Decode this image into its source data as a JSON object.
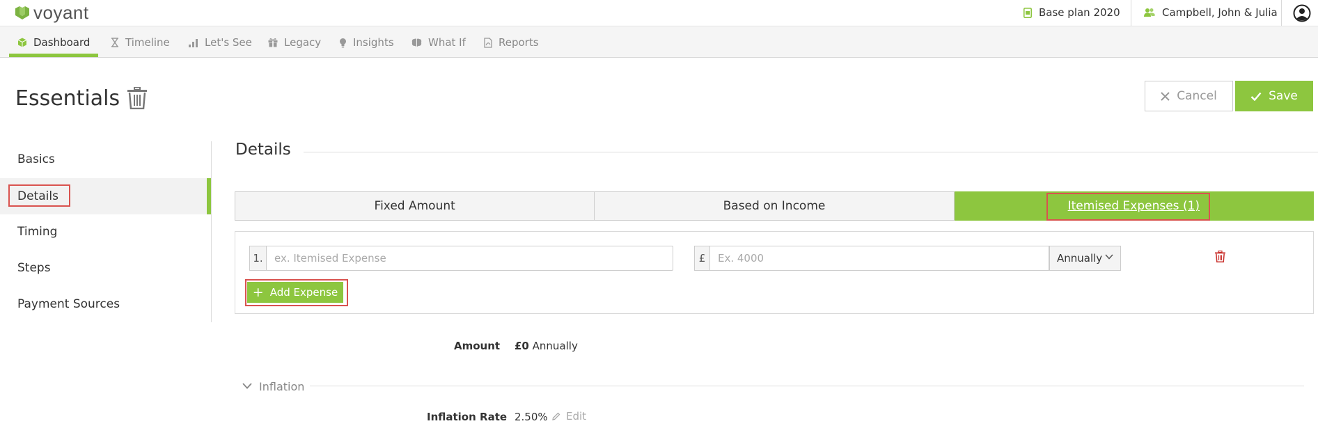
{
  "app": {
    "brand": "voyant",
    "accent": "#8dc63f",
    "highlight": "#d9534f"
  },
  "header": {
    "plan_label": "Base plan 2020",
    "plan_icon": "document-icon",
    "client_label": "Campbell, John & Julia",
    "client_icon": "users-icon",
    "user_icon": "user-avatar-icon"
  },
  "nav": {
    "items": [
      {
        "label": "Dashboard",
        "icon": "cube-icon",
        "active": true
      },
      {
        "label": "Timeline",
        "icon": "hourglass-icon",
        "active": false
      },
      {
        "label": "Let's See",
        "icon": "bar-chart-icon",
        "active": false
      },
      {
        "label": "Legacy",
        "icon": "gift-icon",
        "active": false
      },
      {
        "label": "Insights",
        "icon": "lightbulb-icon",
        "active": false
      },
      {
        "label": "What If",
        "icon": "brain-icon",
        "active": false
      },
      {
        "label": "Reports",
        "icon": "pdf-icon",
        "active": false
      }
    ]
  },
  "page": {
    "title": "Essentials",
    "cancel_label": "Cancel",
    "save_label": "Save"
  },
  "sidebar": {
    "items": [
      {
        "label": "Basics",
        "active": false
      },
      {
        "label": "Details",
        "active": true
      },
      {
        "label": "Timing",
        "active": false
      },
      {
        "label": "Steps",
        "active": false
      },
      {
        "label": "Payment Sources",
        "active": false
      }
    ]
  },
  "details": {
    "title": "Details",
    "tabs": [
      {
        "label": "Fixed Amount",
        "active": false
      },
      {
        "label": "Based on Income",
        "active": false
      },
      {
        "label": "Itemised Expenses (1)",
        "active": true
      }
    ],
    "expense_row": {
      "number": "1.",
      "name_placeholder": "ex. Itemised Expense",
      "currency": "£",
      "amount_placeholder": "Ex. 4000",
      "frequency": "Annually"
    },
    "add_label": "Add Expense",
    "amount_label": "Amount",
    "amount_value": "£0",
    "amount_frequency": "Annually"
  },
  "inflation": {
    "title": "Inflation",
    "rate_label": "Inflation Rate",
    "rate_value": "2.50%",
    "edit_label": "Edit"
  }
}
